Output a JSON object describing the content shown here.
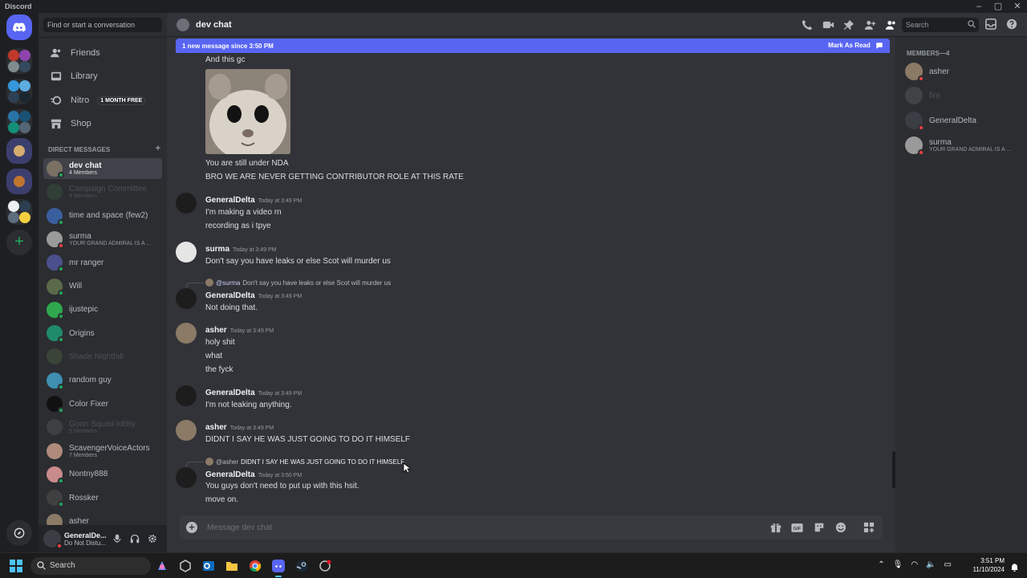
{
  "window": {
    "app_name": "Discord",
    "controls": [
      "–",
      "▢",
      "✕"
    ]
  },
  "colors": {
    "brand": "#5865f2",
    "online": "#23a55a",
    "dnd": "#f23f43",
    "idle": "#f0b232"
  },
  "servers": [
    {
      "name": "server-1"
    },
    {
      "name": "server-2"
    },
    {
      "name": "server-3"
    },
    {
      "name": "server-4"
    },
    {
      "name": "server-5"
    },
    {
      "name": "server-6"
    }
  ],
  "dm_sidebar": {
    "search_placeholder": "Find or start a conversation",
    "nav": [
      {
        "label": "Friends",
        "icon": "friends-icon"
      },
      {
        "label": "Library",
        "icon": "library-icon"
      },
      {
        "label": "Nitro",
        "icon": "nitro-icon",
        "badge": "1 MONTH FREE"
      },
      {
        "label": "Shop",
        "icon": "shop-icon"
      }
    ],
    "section_label": "DIRECT MESSAGES",
    "add_dm": "+",
    "dms": [
      {
        "name": "dev chat",
        "sub": "4 Members",
        "active": true,
        "status": "online",
        "color": "#7a7064"
      },
      {
        "name": "Campaign Committee",
        "sub": "4 Members",
        "muted": true,
        "status": "",
        "color": "#3f6b47"
      },
      {
        "name": "time and space (few2)",
        "sub": "",
        "status": "online",
        "color": "#3a5f9e"
      },
      {
        "name": "surma",
        "sub": "YOUR GRAND ADMIRAL IS A ...",
        "status": "dnd",
        "color": "#9a9a9a"
      },
      {
        "name": "mr ranger",
        "sub": "",
        "status": "online",
        "color": "#4b4f8c"
      },
      {
        "name": "Will",
        "sub": "",
        "status": "online",
        "color": "#5b6b4a"
      },
      {
        "name": "ijustepic",
        "sub": "",
        "status": "online",
        "color": "#2fa84f"
      },
      {
        "name": "Origins",
        "sub": "",
        "status": "online",
        "color": "#1f8b6b"
      },
      {
        "name": "Shade Nightfall",
        "sub": "",
        "muted": true,
        "status": "",
        "color": "#5c7a4a"
      },
      {
        "name": "random guy",
        "sub": "",
        "status": "online",
        "color": "#3e8fb0"
      },
      {
        "name": "Color Fixer",
        "sub": "",
        "status": "online",
        "color": "#111111"
      },
      {
        "name": "Goon Squad lobby",
        "sub": "9 Members",
        "muted": true,
        "status": "",
        "color": "#6b6b6b"
      },
      {
        "name": "ScavengerVoiceActors",
        "sub": "7 Members",
        "status": "",
        "color": "#b08a7a"
      },
      {
        "name": "Nontny888",
        "sub": "",
        "status": "online",
        "color": "#c98b8b"
      },
      {
        "name": "Rossker",
        "sub": "",
        "status": "online",
        "color": "#404040"
      },
      {
        "name": "asher",
        "sub": "",
        "status": "online",
        "color": "#8a7a66"
      }
    ]
  },
  "user_panel": {
    "name": "GeneralDe...",
    "status": "Do Not Distu..."
  },
  "header": {
    "title": "dev chat",
    "search_placeholder": "Search"
  },
  "new_messages_bar": {
    "text": "1 new message since 3:50 PM",
    "action": "Mark As Read"
  },
  "messages": [
    {
      "type": "line",
      "text": "And this gc"
    },
    {
      "type": "line",
      "text": "You are still under NDA"
    },
    {
      "type": "line",
      "text": "BRO WE ARE NEVER GETTING CONTRIBUTOR ROLE AT THIS RATE"
    },
    {
      "type": "head",
      "author": "GeneralDelta",
      "time": "Today at 3:49 PM"
    },
    {
      "type": "line",
      "text": "I'm making a video rn"
    },
    {
      "type": "line",
      "text": "recording as i tpye"
    },
    {
      "type": "head",
      "author": "surma",
      "time": "Today at 3:49 PM"
    },
    {
      "type": "line",
      "text": "Don't say you have leaks or else Scot will murder us"
    },
    {
      "type": "reply",
      "mention": "@surma",
      "text": "Don't say you have leaks or else Scot will murder us"
    },
    {
      "type": "head",
      "author": "GeneralDelta",
      "time": "Today at 3:49 PM"
    },
    {
      "type": "line",
      "text": "Not doing that."
    },
    {
      "type": "head",
      "author": "asher",
      "time": "Today at 3:49 PM"
    },
    {
      "type": "line",
      "text": "holy shit"
    },
    {
      "type": "line",
      "text": "what"
    },
    {
      "type": "line",
      "text": "the fyck"
    },
    {
      "type": "head",
      "author": "GeneralDelta",
      "time": "Today at 3:49 PM"
    },
    {
      "type": "line",
      "text": "I'm not leaking anything."
    },
    {
      "type": "head",
      "author": "asher",
      "time": "Today at 3:49 PM"
    },
    {
      "type": "line",
      "text": "DIDNT I SAY HE WAS JUST GOING TO DO IT HIMSELF"
    },
    {
      "type": "reply",
      "mention": "@asher",
      "text": "DIDNT I SAY HE WAS JUST GOING TO DO IT HIMSELF"
    },
    {
      "type": "head",
      "author": "GeneralDelta",
      "time": "Today at 3:50 PM"
    },
    {
      "type": "line",
      "text": "You guys don't need to put up with this hsit."
    },
    {
      "type": "line",
      "text": "move on."
    }
  ],
  "composer": {
    "placeholder": "Message dev chat"
  },
  "members": {
    "header": "MEMBERS—4",
    "list": [
      {
        "name": "asher",
        "sub": "",
        "color": "#8a7a66"
      },
      {
        "name": "fire",
        "sub": "",
        "offline": true,
        "color": "#6b6b6b"
      },
      {
        "name": "GeneralDelta",
        "sub": "",
        "color": "#3b3d44"
      },
      {
        "name": "surma",
        "sub": "YOUR GRAND ADMIRAL IS A ...",
        "color": "#9a9a9a"
      }
    ]
  },
  "taskbar": {
    "search_label": "Search",
    "clock_time": "3:51 PM",
    "clock_date": "11/10/2024"
  }
}
